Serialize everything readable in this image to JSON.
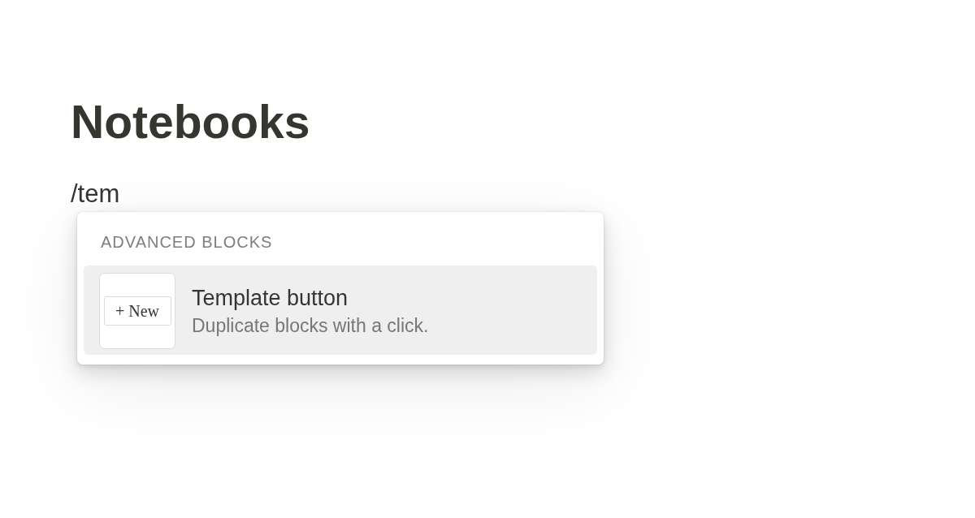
{
  "page": {
    "title": "Notebooks",
    "typed_text": "/tem"
  },
  "menu": {
    "section": "ADVANCED BLOCKS",
    "items": [
      {
        "title": "Template button",
        "description": "Duplicate blocks with a click.",
        "preview_label": "+ New",
        "selected": true
      }
    ]
  }
}
